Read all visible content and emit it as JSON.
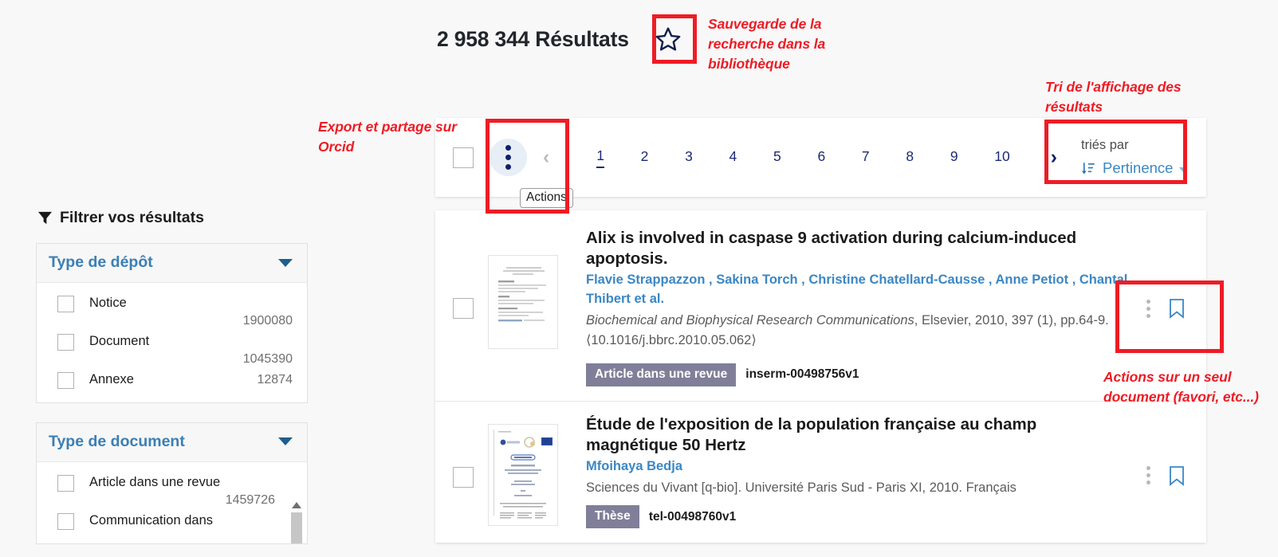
{
  "header": {
    "results_count": "2 958 344 Résultats",
    "save_search_icon": "star-icon"
  },
  "annotations": [
    {
      "id": "save-search",
      "text": "Sauvegarde de la recherche dans la bibliothèque"
    },
    {
      "id": "export-orcid",
      "text": "Export et partage sur Orcid"
    },
    {
      "id": "sort-results",
      "text": "Tri de l'affichage des résultats"
    },
    {
      "id": "single-doc-actions",
      "text": "Actions sur un seul document (favori, etc...)"
    }
  ],
  "sidebar": {
    "filter_heading": "Filtrer vos résultats",
    "filter_icon": "funnel-icon",
    "facets": [
      {
        "title": "Type de dépôt",
        "options": [
          {
            "label": "Notice",
            "count": "1900080"
          },
          {
            "label": "Document",
            "count": "1045390"
          },
          {
            "label": "Annexe",
            "count": "12874"
          }
        ]
      },
      {
        "title": "Type de document",
        "options": [
          {
            "label": "Article dans une revue",
            "count": "1459726"
          },
          {
            "label": "Communication dans",
            "count": ""
          }
        ]
      }
    ]
  },
  "toolbar": {
    "actions_tooltip": "Actions",
    "actions_icon": "three-dots-vertical-icon",
    "prev_label": "‹",
    "next_label": "›",
    "pages": [
      "1",
      "2",
      "3",
      "4",
      "5",
      "6",
      "7",
      "8",
      "9",
      "10"
    ],
    "active_page": "1",
    "sort_label": "triés par",
    "sort_value": "Pertinence",
    "sort_icon": "sort-descending-icon"
  },
  "results": [
    {
      "title": "Alix is involved in caspase 9 activation during calcium-induced apoptosis.",
      "authors": "Flavie Strappazzon , Sakina Torch , Christine Chatellard-Causse , Anne Petiot , Chantal Thibert et al.",
      "source_italic": "Biochemical and Biophysical Research Communications",
      "source_rest": ", Elsevier, 2010, 397 (1), pp.64-9. ⟨10.1016/j.bbrc.2010.05.062⟩",
      "badge": "Article dans une revue",
      "doc_id": "inserm-00498756v1"
    },
    {
      "title": "Étude de l'exposition de la population française au champ magnétique 50 Hertz",
      "authors": "Mfoihaya Bedja",
      "source_italic": "",
      "source_rest": "Sciences du Vivant [q-bio]. Université Paris Sud - Paris XI, 2010. Français",
      "badge": "Thèse",
      "doc_id": "tel-00498760v1"
    }
  ],
  "colors": {
    "annotation_red": "#ee1c25",
    "link_blue": "#3b87c4",
    "pager_navy": "#1b2a75",
    "badge_gray": "#7f7f99",
    "page_bg": "#f8f8f8"
  }
}
